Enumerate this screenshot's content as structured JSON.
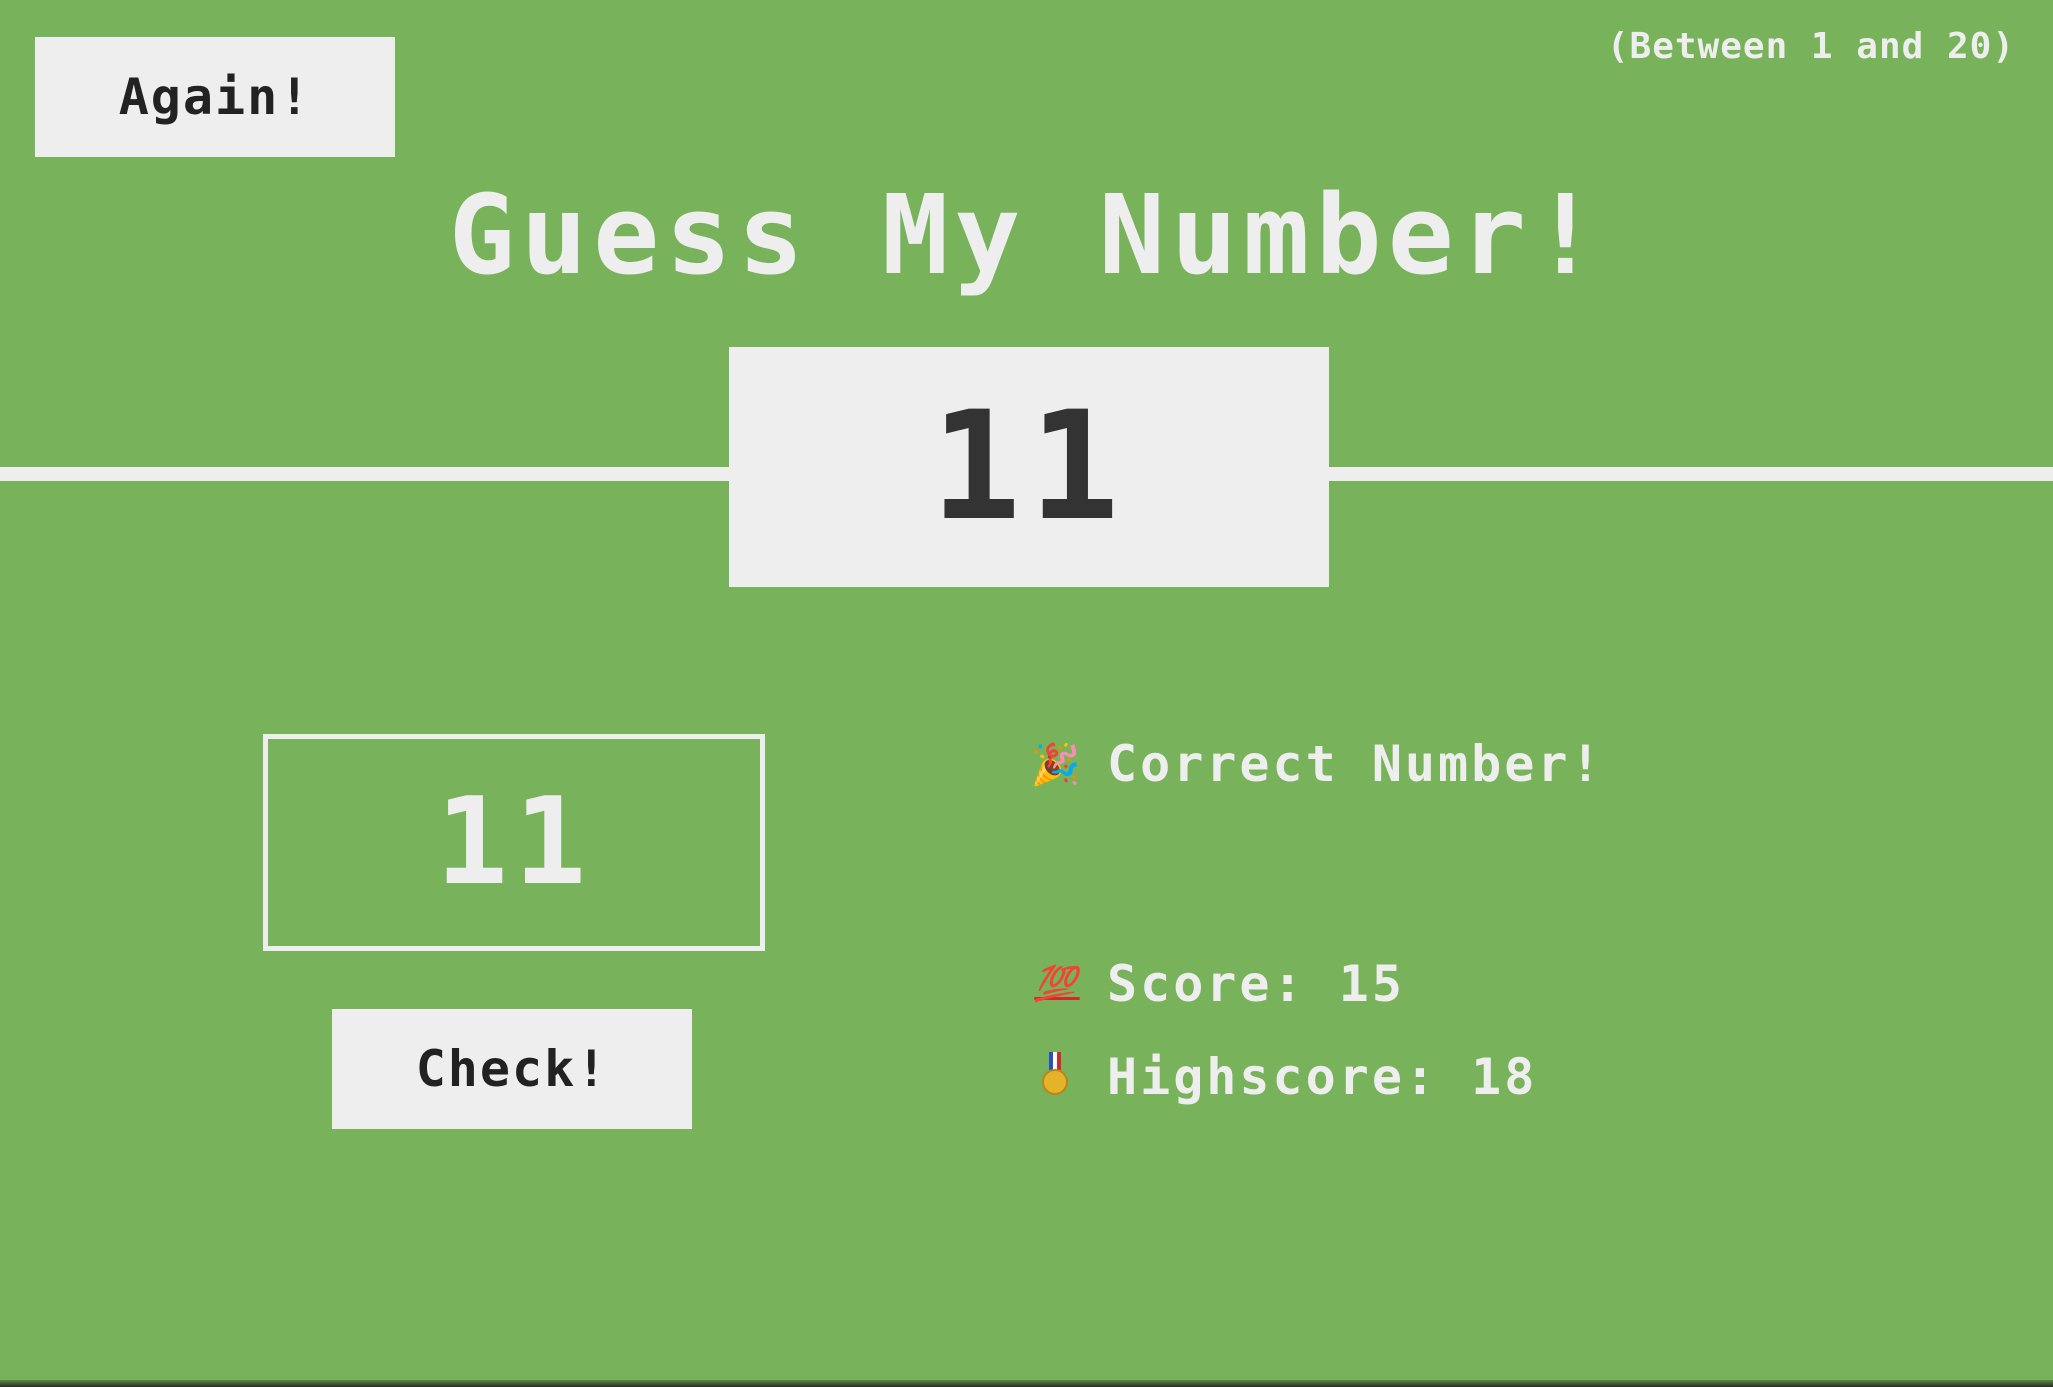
{
  "header": {
    "again_label": "Again!",
    "range_text": "(Between 1 and 20)",
    "title": "Guess My Number!"
  },
  "secret_number": "11",
  "guess": {
    "value": "11",
    "check_label": "Check!"
  },
  "status": {
    "message_icon": "party-popper-icon",
    "message": "Correct Number!",
    "score_icon": "hundred-points-icon",
    "score_label": "Score: 15",
    "highscore_icon": "medal-icon",
    "highscore_label": "Highscore: 18"
  },
  "colors": {
    "background": "#78b25a",
    "panel": "#eeeeee",
    "text_dark": "#333333"
  }
}
